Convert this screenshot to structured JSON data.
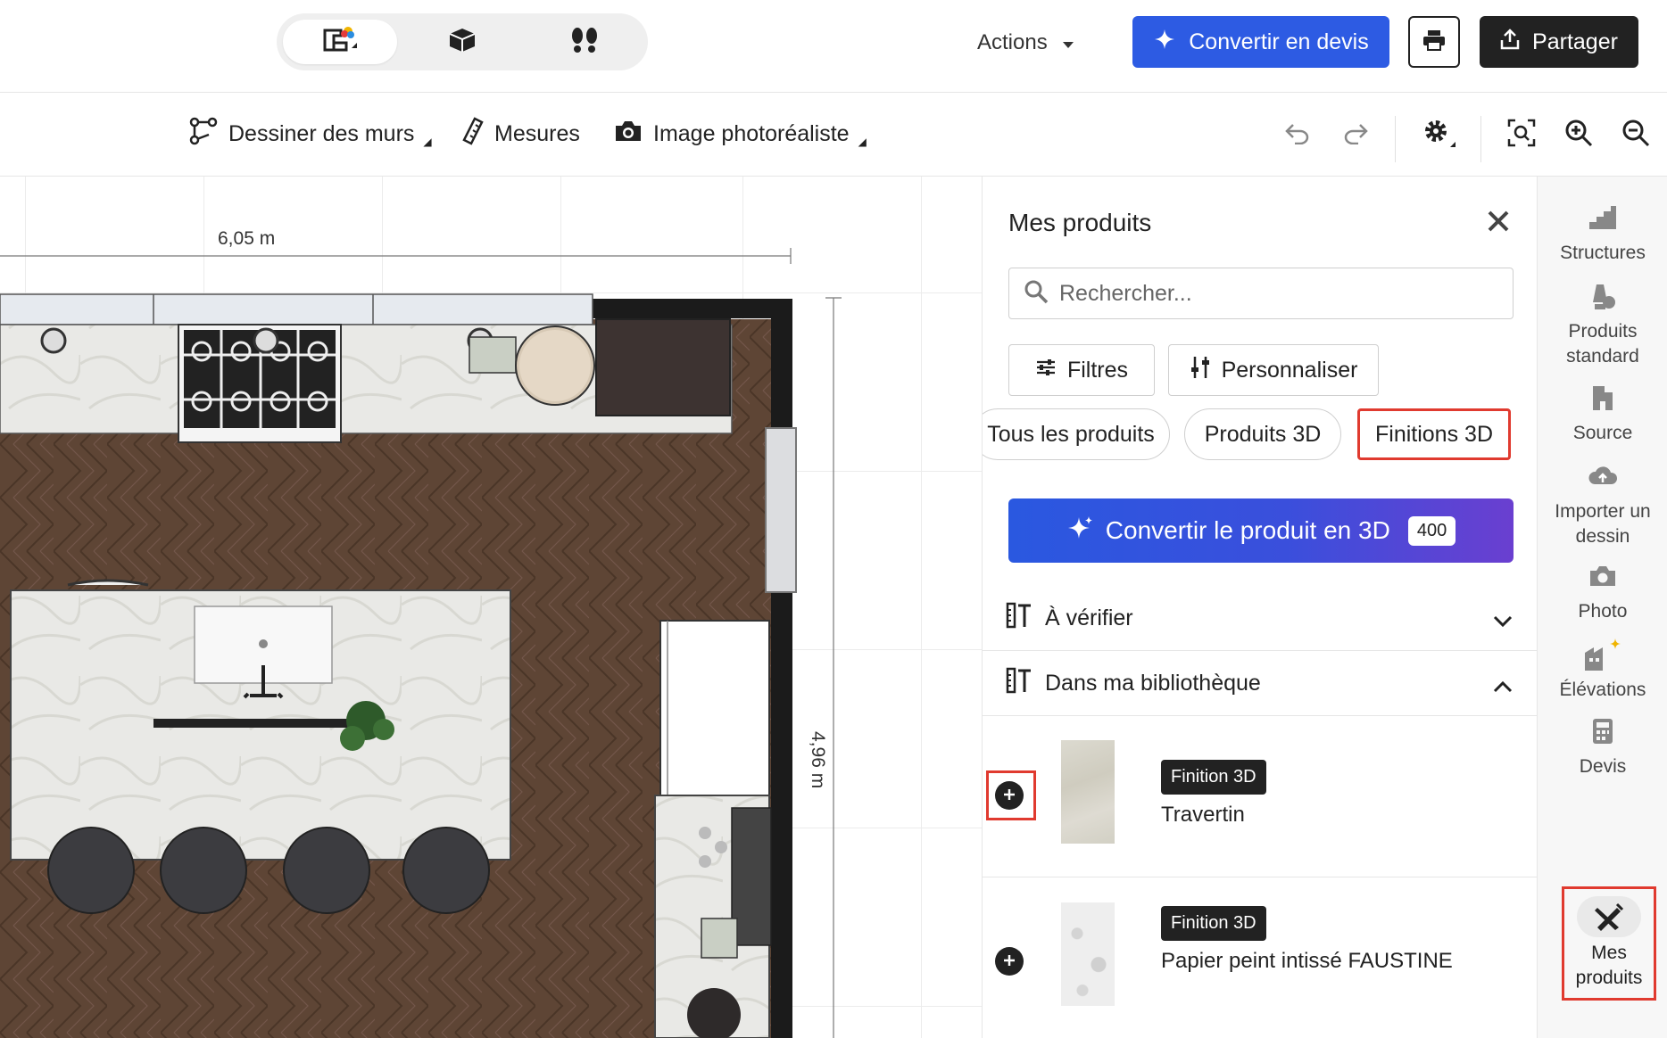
{
  "topbar": {
    "view_modes": [
      "2d-plan",
      "3d-view",
      "walkthrough"
    ],
    "actions_label": "Actions",
    "convert_quote_label": "Convertir en devis",
    "share_label": "Partager"
  },
  "toolbar": {
    "draw_walls_label": "Dessiner des murs",
    "measures_label": "Mesures",
    "photo_image_label": "Image photoréaliste"
  },
  "canvas": {
    "width_dimension": "6,05 m",
    "height_dimension": "4,96 m"
  },
  "panel": {
    "title": "Mes produits",
    "search_placeholder": "Rechercher...",
    "filters_label": "Filtres",
    "customize_label": "Personnaliser",
    "chips": [
      "Tous les produits",
      "Produits 3D",
      "Finitions 3D"
    ],
    "selected_chip": "Finitions 3D",
    "convert_3d_label": "Convertir le produit en 3D",
    "convert_3d_credits": "400",
    "sections": {
      "to_verify": "À vérifier",
      "in_library": "Dans ma bibliothèque"
    },
    "products": [
      {
        "badge": "Finition 3D",
        "name": "Travertin"
      },
      {
        "badge": "Finition 3D",
        "name": "Papier peint intissé FAUSTINE"
      }
    ]
  },
  "rail": {
    "items": [
      "Structures",
      "Produits standard",
      "Source",
      "Importer un dessin",
      "Photo",
      "Élévations",
      "Devis",
      "Mes produits"
    ]
  },
  "colors": {
    "primary_blue": "#2d5be3",
    "dark": "#222222",
    "highlight_red": "#e03a2f",
    "floor_wood": "#5e4535"
  }
}
